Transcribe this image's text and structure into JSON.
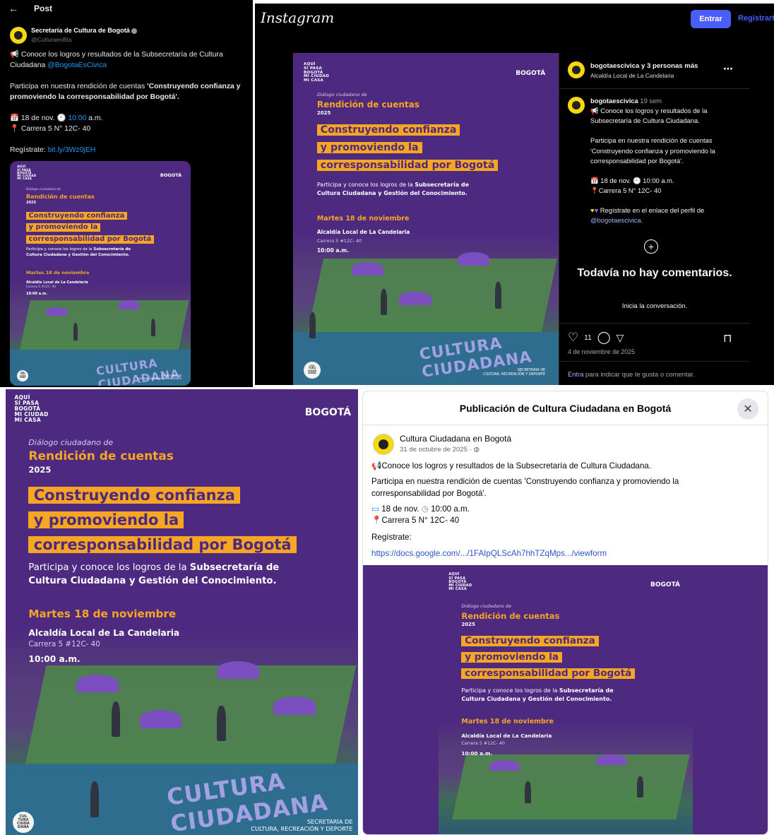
{
  "twitter": {
    "header": {
      "title": "Post"
    },
    "author": {
      "name": "Secretaría de Cultura de Bogotá",
      "handle": "@CulturaenBta"
    },
    "body": {
      "intro": "Conoce los logros y resultados de la Subsecretaría de Cultura Ciudadana",
      "mention": "@BogotaEsCivica",
      "invite_plain": "Participa en nuestra rendición de cuentas ",
      "invite_bold": "'Construyendo confianza y promoviendo la corresponsabilidad por Bogotá'.",
      "date": "18 de nov.",
      "time": "10:00",
      "time_suffix": "a.m.",
      "address": "Carrera 5 N° 12C- 40",
      "register_label": "Regístrate:",
      "register_link": "bit.ly/3Wz0jEH"
    }
  },
  "instagram": {
    "brand": "Instagram",
    "login_button": "Entrar",
    "signup_link": "Registrarte",
    "header": {
      "title": "bogotaescivica y 3 personas más",
      "subtitle": "Alcaldía Local de La Candelaria"
    },
    "caption": {
      "username": "bogotaescivica",
      "age": "19 sem",
      "line1": "Conoce los logros y resultados de la Subsecretaría de Cultura Ciudadana.",
      "line2": "Participa en nuestra rendición de cuentas 'Construyendo confianza y promoviendo la corresponsabilidad por Bogotá'.",
      "date": "18 de nov.",
      "time": "10:00 a.m.",
      "address": "Carrera 5 N° 12C- 40",
      "register": "Regístrate en el enlace del perfil de",
      "profile_link": "@bogotaescivica."
    },
    "comments": {
      "empty_title": "Todavía no hay comentarios.",
      "empty_sub": "Inicia la conversación."
    },
    "likes": "11",
    "post_date": "4 de noviembre de 2025",
    "footer_link": "Entra",
    "footer_text": "para indicar que te gusta o comentar."
  },
  "poster": {
    "logo_left": [
      "AQUÍ",
      "SÍ PASA",
      "BOGOTÁ",
      "MI CIUDAD",
      "MI CASA"
    ],
    "logo_right": "BOGOTÁ",
    "dialogo": "Diálogo ciudadano de",
    "rendicion": "Rendición de cuentas",
    "year": "2025",
    "headline": [
      "Construyendo confianza",
      "y promoviendo la",
      "corresponsabilidad por Bogotá"
    ],
    "participa_plain": "Participa y conoce los logros de la ",
    "participa_bold_1": "Subsecretaría de",
    "participa_bold_2": "Cultura Ciudadana y Gestión del Conocimiento.",
    "date": "Martes 18 de noviembre",
    "place": "Alcaldía Local de La Candelaria",
    "address": "Carrera 5 #12C- 40",
    "time": "10:00 a.m.",
    "cultura": [
      "CULTURA",
      "CIUDADANA"
    ],
    "secretaria_1": "SECRETARÍA DE",
    "secretaria_2": "CULTURA, RECREACIÓN Y DEPORTE",
    "badge": [
      "CUL",
      "TURA",
      "CIUDA",
      "DANA"
    ]
  },
  "facebook": {
    "dialog_title": "Publicación de Cultura Ciudadana en Bogotá",
    "author": "Cultura Ciudadana en Bogotá",
    "date": "31 de octubre de 2025 ·",
    "line1": "Conoce los logros y resultados de la Subsecretaría de Cultura Ciudadana.",
    "line2": "Participa en nuestra rendición de cuentas 'Construyendo confianza y promoviendo la corresponsabilidad por Bogotá'.",
    "event_date": "18 de nov.",
    "event_time": "10:00 a.m.",
    "address": "Carrera 5 N° 12C- 40",
    "register_label": "Regístrate:",
    "register_link": "https://docs.google.com/.../1FAIpQLScAh7hhTZqMps.../viewform"
  },
  "colors": {
    "purple": "#4d2a80",
    "orange": "#f6a623",
    "twitter_link": "#1d9bf0",
    "ig_button": "#4a5df9",
    "fb_link": "#2a56c6"
  }
}
